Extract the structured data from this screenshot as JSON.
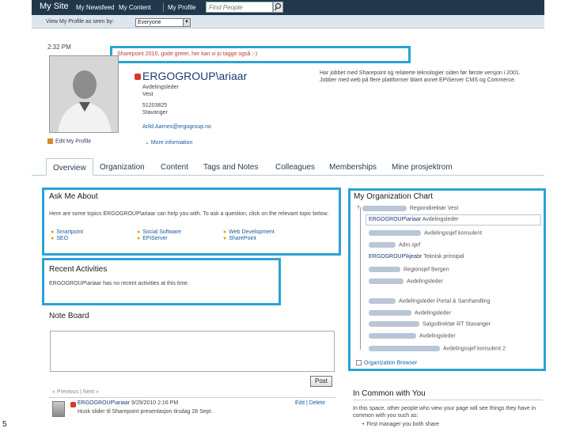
{
  "topbar": {
    "site": "My Site",
    "nav": [
      "My Newsfeed",
      "My Content",
      "My Profile"
    ],
    "search_placeholder": "Find People"
  },
  "viewbar": {
    "label": "View My Profile as seen by:",
    "selected": "Everyone"
  },
  "status": {
    "time": "2:32 PM",
    "text": "Sharepoint 2010, gode greier, her kan vi jo tagge også :-)"
  },
  "profile": {
    "edit_label": "Edit My Profile",
    "name": "ERGOGROUP\\ariaar",
    "title": "Avdelingsleder",
    "dept": "Vest",
    "phone": "51203825",
    "city": "Stavanger",
    "email": "Arild.Aarnes@ergogroup.no",
    "more": "More information",
    "about": "Har jobbet med Sharepoint og relaterte teknologier siden før første versjon i 2001. Jobber med web på flere plattformer blant annet EPiServer CMS og Commerce."
  },
  "tabs": [
    "Overview",
    "Organization",
    "Content",
    "Tags and Notes",
    "Colleagues",
    "Memberships",
    "Mine prosjektrom"
  ],
  "ask": {
    "title": "Ask Me About",
    "intro": "Here are some topics ERGOGROUP\\ariaar can help you with. To ask a question, click on the relevant topic below.",
    "topics": [
      "Smartpoint",
      "SEO",
      "Social Software",
      "EPiServer",
      "Web Development",
      "SharePoint"
    ]
  },
  "activities": {
    "title": "Recent Activities",
    "text": "ERGOGROUP\\ariaar has no recent activities at this time."
  },
  "org": {
    "title": "My Organization Chart",
    "rows": [
      {
        "name": "",
        "role": "Regiondirektør Vest"
      },
      {
        "name": "ERGOGROUP\\ariaar",
        "role": "Avdelingsleder"
      },
      {
        "name": "",
        "role": "Avdelingssjef konsulent"
      },
      {
        "name": "",
        "role": "Adm.sjef"
      },
      {
        "name": "ERGOGROUP\\kjeabr",
        "role": "Teknisk prinsipal"
      },
      {
        "name": "",
        "role": "Regionsjef Bergen"
      },
      {
        "name": "",
        "role": "Avdelingsleder"
      },
      {
        "name": "",
        "role": "Avdelingsleder Portal & Samhandling"
      },
      {
        "name": "",
        "role": "Avdelingsleder"
      },
      {
        "name": "",
        "role": "Salgsdirektør RT Stavanger"
      },
      {
        "name": "",
        "role": "Avdelingsleder"
      },
      {
        "name": "",
        "role": "Avdelingssjef konsulent 2"
      }
    ],
    "browser": "Organization Browser"
  },
  "noteboard": {
    "title": "Note Board",
    "post": "Post",
    "pager": "« Previous  |  Next »",
    "author": "ERGOGROUP\\ariaar",
    "date": "9/29/2010 2:16 PM",
    "text": "Husk slider til Sharepoint presentasjon tirsdag 28 Sept.",
    "actions": "Edit | Delete"
  },
  "common": {
    "title": "In Common with You",
    "text": "In this space, other people who view your page will see things they have in common with you such as:",
    "item": "First manager you both share"
  },
  "page_number": "5",
  "colors": {
    "topbar": "#21374c",
    "highlight": "#2ba3d4",
    "link": "#1a5aa0"
  }
}
